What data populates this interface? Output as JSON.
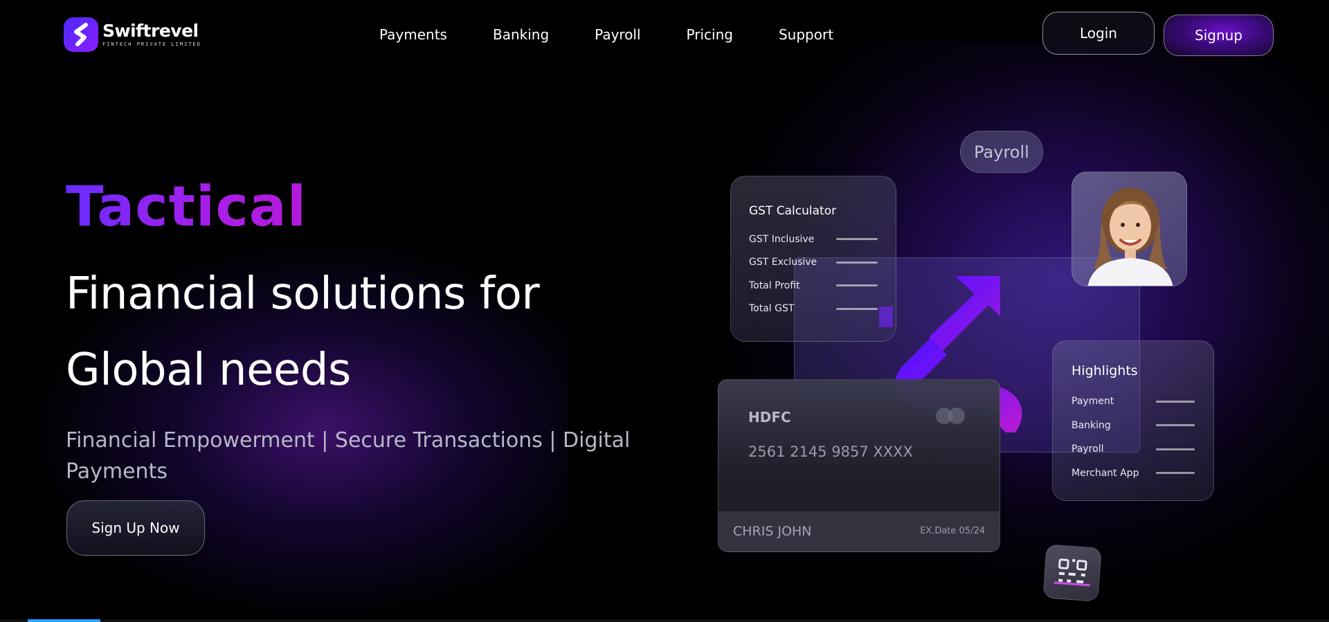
{
  "brand": {
    "name": "Swiftrevel",
    "subtitle": "FINTECH PRIVATE LIMITED",
    "logo_icon": "swiftrevel-s-logo"
  },
  "nav": {
    "items": [
      {
        "label": "Payments"
      },
      {
        "label": "Banking"
      },
      {
        "label": "Payroll"
      },
      {
        "label": "Pricing"
      },
      {
        "label": "Support"
      }
    ],
    "login_label": "Login",
    "signup_label": "Signup"
  },
  "hero": {
    "kicker": "Tactical",
    "title_line1": "Financial solutions for",
    "title_line2": "Global needs",
    "subtitle": "Financial Empowerment | Secure Transactions | Digital Payments",
    "cta_label": "Sign Up Now"
  },
  "illustration": {
    "payroll_pill": "Payroll",
    "gst_card": {
      "title": "GST Calculator",
      "rows": [
        "GST Inclusive",
        "GST Exclusive",
        "Total Profit",
        "Total GST"
      ]
    },
    "highlights_card": {
      "title": "Highlights",
      "rows": [
        "Payment",
        "Banking",
        "Payroll",
        "Merchant App"
      ]
    },
    "bank_card": {
      "bank": "HDFC",
      "number": "2561 2145 9857 XXXX",
      "holder": "CHRIS JOHN",
      "expiry": "EX.Date 05/24"
    },
    "avatar_icon": "person-avatar",
    "qr_icon": "qr-code-icon"
  },
  "colors": {
    "accent_purple": "#8a1dff",
    "accent_blue": "#4b2bff",
    "background": "#000000",
    "scroll_thumb": "#2b9dff"
  }
}
